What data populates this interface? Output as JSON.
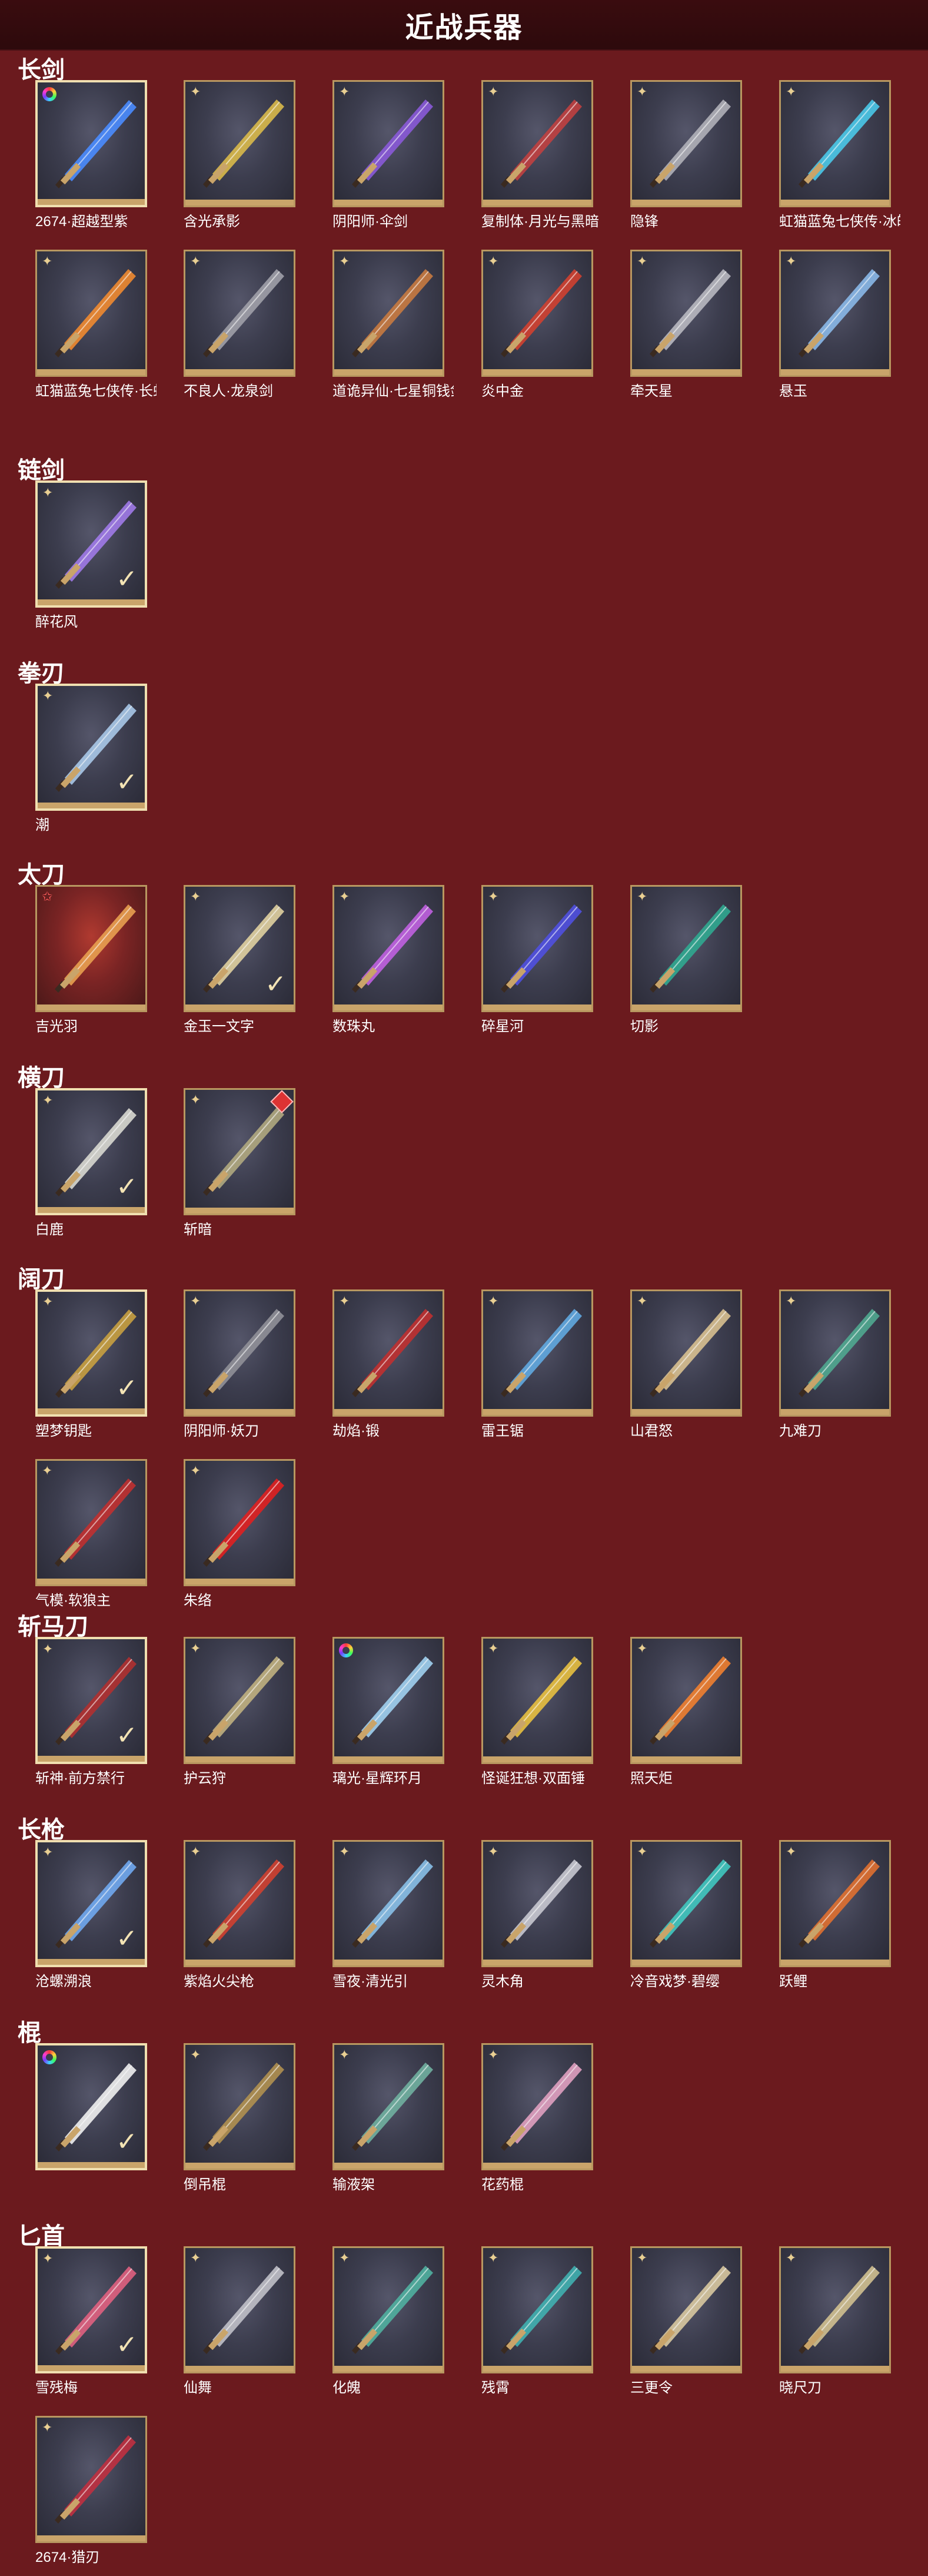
{
  "page": {
    "title": "近战兵器"
  },
  "sections": [
    {
      "name": "长剑",
      "items": [
        {
          "name": "2674·超越型紫",
          "corner": "rainbow",
          "check": false,
          "sel": true,
          "color": "#4a8cff"
        },
        {
          "name": "含光承影",
          "corner": "x",
          "check": false,
          "sel": false,
          "color": "#d9b94a"
        },
        {
          "name": "阴阳师·伞剑",
          "corner": "x",
          "check": false,
          "sel": false,
          "color": "#8a5ad8"
        },
        {
          "name": "复制体·月光与黑暗",
          "corner": "x",
          "check": false,
          "sel": false,
          "color": "#c04040"
        },
        {
          "name": "隐锋",
          "corner": "x",
          "check": false,
          "sel": false,
          "color": "#b0b0b8"
        },
        {
          "name": "虹猫蓝兔七侠传·冰魄剑",
          "corner": "x",
          "check": false,
          "sel": false,
          "color": "#4ac8e8"
        },
        {
          "name": "虹猫蓝兔七侠传·长虹剑",
          "corner": "x",
          "check": false,
          "sel": false,
          "color": "#f08a30"
        },
        {
          "name": "不良人·龙泉剑",
          "corner": "x",
          "check": false,
          "sel": false,
          "color": "#a0a0a8"
        },
        {
          "name": "道诡异仙·七星铜钱剑",
          "corner": "x",
          "check": false,
          "sel": false,
          "color": "#c87a40"
        },
        {
          "name": "炎中金",
          "corner": "x",
          "check": false,
          "sel": false,
          "color": "#d04030"
        },
        {
          "name": "牵天星",
          "corner": "x",
          "check": false,
          "sel": false,
          "color": "#b8b8c0"
        },
        {
          "name": "悬玉",
          "corner": "x",
          "check": false,
          "sel": false,
          "color": "#8ab8e8"
        }
      ]
    },
    {
      "name": "链剑",
      "items": [
        {
          "name": "醉花风",
          "corner": "x",
          "check": true,
          "sel": true,
          "color": "#a07ae8"
        }
      ]
    },
    {
      "name": "拳刃",
      "items": [
        {
          "name": "潮",
          "corner": "x",
          "check": true,
          "sel": true,
          "color": "#a8c8e8"
        }
      ]
    },
    {
      "name": "太刀",
      "items": [
        {
          "name": "吉光羽",
          "corner": "star",
          "check": false,
          "sel": false,
          "color": "#e8a050",
          "red": true
        },
        {
          "name": "金玉一文字",
          "corner": "x",
          "check": true,
          "sel": false,
          "color": "#e0d0a0"
        },
        {
          "name": "数珠丸",
          "corner": "x",
          "check": false,
          "sel": false,
          "color": "#c060e0"
        },
        {
          "name": "碎星河",
          "corner": "x",
          "check": false,
          "sel": false,
          "color": "#5050e0"
        },
        {
          "name": "切影",
          "corner": "x",
          "check": false,
          "sel": false,
          "color": "#30a890"
        }
      ]
    },
    {
      "name": "横刀",
      "items": [
        {
          "name": "白鹿",
          "corner": "x",
          "check": true,
          "sel": true,
          "color": "#d8d8d0"
        },
        {
          "name": "斩暗",
          "corner": "x",
          "check": false,
          "sel": false,
          "color": "#b0a880",
          "badge": true
        }
      ]
    },
    {
      "name": "阔刀",
      "items": [
        {
          "name": "塑梦钥匙",
          "corner": "x",
          "check": true,
          "sel": true,
          "color": "#c8a040"
        },
        {
          "name": "阴阳师·妖刀",
          "corner": "x",
          "check": false,
          "sel": false,
          "color": "#909098"
        },
        {
          "name": "劫焰·锻",
          "corner": "x",
          "check": false,
          "sel": false,
          "color": "#c03030"
        },
        {
          "name": "雷王锯",
          "corner": "x",
          "check": false,
          "sel": false,
          "color": "#60a8e0"
        },
        {
          "name": "山君怒",
          "corner": "x",
          "check": false,
          "sel": false,
          "color": "#d8c090"
        },
        {
          "name": "九难刀",
          "corner": "x",
          "check": false,
          "sel": false,
          "color": "#50a890"
        },
        {
          "name": "气模·软狼主",
          "corner": "x",
          "check": false,
          "sel": false,
          "color": "#c03030"
        },
        {
          "name": "朱络",
          "corner": "x",
          "check": false,
          "sel": false,
          "color": "#e02020"
        }
      ]
    },
    {
      "name": "斩马刀",
      "items": [
        {
          "name": "斩神·前方禁行",
          "corner": "x",
          "check": true,
          "sel": true,
          "color": "#b03030"
        },
        {
          "name": "护云狩",
          "corner": "x",
          "check": false,
          "sel": false,
          "color": "#c0b080"
        },
        {
          "name": "璃光·星辉环月",
          "corner": "rainbow",
          "check": false,
          "sel": false,
          "color": "#a0d0f0"
        },
        {
          "name": "怪诞狂想·双面锤",
          "corner": "x",
          "check": false,
          "sel": false,
          "color": "#e8c040"
        },
        {
          "name": "照天炬",
          "corner": "x",
          "check": false,
          "sel": false,
          "color": "#f08030"
        }
      ]
    },
    {
      "name": "长枪",
      "items": [
        {
          "name": "沧螺溯浪",
          "corner": "x",
          "check": true,
          "sel": true,
          "color": "#70a8f0"
        },
        {
          "name": "紫焰火尖枪",
          "corner": "x",
          "check": false,
          "sel": false,
          "color": "#d04030"
        },
        {
          "name": "雪夜·清光引",
          "corner": "x",
          "check": false,
          "sel": false,
          "color": "#88c0e8"
        },
        {
          "name": "灵木角",
          "corner": "x",
          "check": false,
          "sel": false,
          "color": "#c8c8d0"
        },
        {
          "name": "冷音戏梦·碧缨",
          "corner": "x",
          "check": false,
          "sel": false,
          "color": "#40c8c0"
        },
        {
          "name": "跃鲤",
          "corner": "x",
          "check": false,
          "sel": false,
          "color": "#e07030"
        }
      ]
    },
    {
      "name": "棍",
      "items": [
        {
          "name": "",
          "corner": "rainbow",
          "check": true,
          "sel": true,
          "color": "#f0f0f0"
        },
        {
          "name": "倒吊棍",
          "corner": "x",
          "check": false,
          "sel": false,
          "color": "#b09050"
        },
        {
          "name": "输液架",
          "corner": "x",
          "check": false,
          "sel": false,
          "color": "#70b0a0"
        },
        {
          "name": "花药棍",
          "corner": "x",
          "check": false,
          "sel": false,
          "color": "#e0a0c0"
        }
      ]
    },
    {
      "name": "匕首",
      "items": [
        {
          "name": "雪残梅",
          "corner": "x",
          "check": true,
          "sel": true,
          "color": "#e06080"
        },
        {
          "name": "仙舞",
          "corner": "x",
          "check": false,
          "sel": false,
          "color": "#c0c0c8"
        },
        {
          "name": "化魄",
          "corner": "x",
          "check": false,
          "sel": false,
          "color": "#50b0a0"
        },
        {
          "name": "残霄",
          "corner": "x",
          "check": false,
          "sel": false,
          "color": "#40b0b0"
        },
        {
          "name": "三更令",
          "corner": "x",
          "check": false,
          "sel": false,
          "color": "#d8c8a0"
        },
        {
          "name": "晓尺刀",
          "corner": "x",
          "check": false,
          "sel": false,
          "color": "#d0c090"
        },
        {
          "name": "2674·猎刃",
          "corner": "x",
          "check": false,
          "sel": false,
          "color": "#c03040"
        }
      ]
    }
  ]
}
